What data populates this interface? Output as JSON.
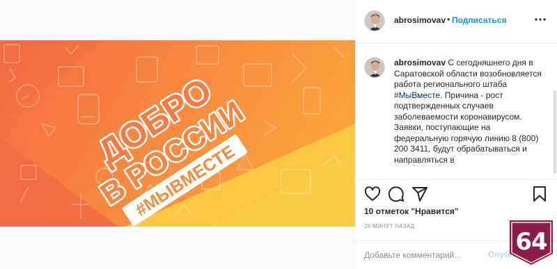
{
  "post": {
    "image": {
      "title_line1": "ДОБРО",
      "title_line2": "В РОССИИ",
      "hashtag": "#МЫВМЕСТЕ",
      "colors": {
        "orange_left": "#f57a45",
        "orange_mid": "#f99a3c",
        "yellow": "#fcc542",
        "white": "#ffffff"
      }
    },
    "header": {
      "username": "abrosimovav",
      "separator": "•",
      "follow_label": "Подписаться",
      "more_icon": "more-horizontal-icon"
    },
    "caption": {
      "username": "abrosimovav",
      "text_before_tag": " С сегодняшнего дня в Саратовской области возобновляется работа регионального штаба ",
      "hashtag": "#МыВместе",
      "text_after_tag": ". Причина - рост подтвержденных случаев заболеваемости коронавирусом.",
      "paragraph2": "Заявки, поступающие на федеральную горячую линию 8 (800) 200 3411, будут обрабатываться и направляться в"
    },
    "actions": {
      "like_icon": "heart-icon",
      "comment_icon": "comment-icon",
      "share_icon": "share-icon",
      "save_icon": "bookmark-icon"
    },
    "likes_text": "10 отметок \"Нравится\"",
    "timestamp": "26 МИНУТ НАЗАД",
    "comment": {
      "placeholder": "Добавьте комментарий...",
      "post_label": "Опубликовать"
    }
  },
  "watermark": {
    "text": "64",
    "color": "#8c1d48"
  },
  "theme": {
    "link_color": "#0095f6",
    "hashtag_color": "#00376b",
    "secondary_text": "#8e8e8e",
    "border": "#efefef"
  }
}
